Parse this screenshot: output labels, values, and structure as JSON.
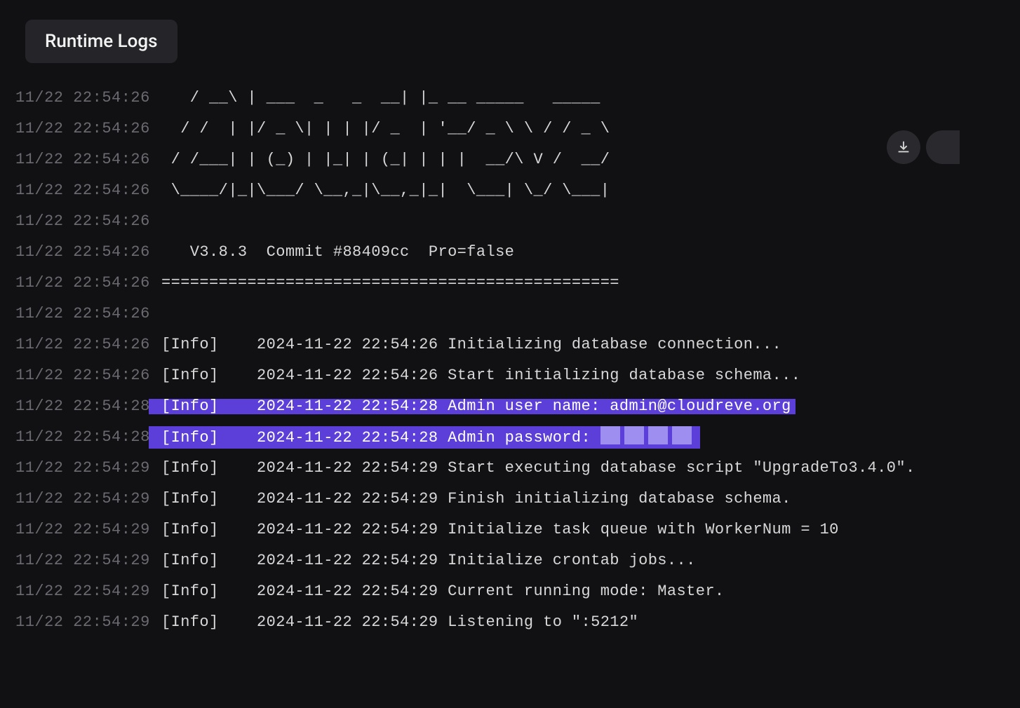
{
  "tab": {
    "label": "Runtime Logs"
  },
  "icons": {
    "download": "download-icon"
  },
  "log": {
    "lines": [
      {
        "ts": "11/22 22:54:26",
        "msg": "   / __\\ | ___  _   _  __| |_ __ _____   _____",
        "hl": false
      },
      {
        "ts": "11/22 22:54:26",
        "msg": "  / /  | |/ _ \\| | | |/ _  | '__/ _ \\ \\ / / _ \\",
        "hl": false
      },
      {
        "ts": "11/22 22:54:26",
        "msg": " / /___| | (_) | |_| | (_| | | |  __/\\ V /  __/",
        "hl": false
      },
      {
        "ts": "11/22 22:54:26",
        "msg": " \\____/|_|\\___/ \\__,_|\\__,_|_|  \\___| \\_/ \\___|",
        "hl": false
      },
      {
        "ts": "11/22 22:54:26",
        "msg": "",
        "hl": false
      },
      {
        "ts": "11/22 22:54:26",
        "msg": "   V3.8.3  Commit #88409cc  Pro=false",
        "hl": false
      },
      {
        "ts": "11/22 22:54:26",
        "msg": "================================================",
        "hl": false
      },
      {
        "ts": "11/22 22:54:26",
        "msg": "",
        "hl": false
      },
      {
        "ts": "11/22 22:54:26",
        "msg": "[Info]    2024-11-22 22:54:26 Initializing database connection...",
        "hl": false
      },
      {
        "ts": "11/22 22:54:26",
        "msg": "[Info]    2024-11-22 22:54:26 Start initializing database schema...",
        "hl": false
      },
      {
        "ts": "11/22 22:54:28",
        "msg": "[Info]    2024-11-22 22:54:28 Admin user name: admin@cloudreve.org",
        "hl": true
      },
      {
        "ts": "11/22 22:54:28",
        "msg": "[Info]    2024-11-22 22:54:28 Admin password: ",
        "hl": true,
        "redacted": true
      },
      {
        "ts": "11/22 22:54:29",
        "msg": "[Info]    2024-11-22 22:54:29 Start executing database script \"UpgradeTo3.4.0\".",
        "hl": false
      },
      {
        "ts": "11/22 22:54:29",
        "msg": "[Info]    2024-11-22 22:54:29 Finish initializing database schema.",
        "hl": false
      },
      {
        "ts": "11/22 22:54:29",
        "msg": "[Info]    2024-11-22 22:54:29 Initialize task queue with WorkerNum = 10",
        "hl": false
      },
      {
        "ts": "11/22 22:54:29",
        "msg": "[Info]    2024-11-22 22:54:29 Initialize crontab jobs...",
        "hl": false
      },
      {
        "ts": "11/22 22:54:29",
        "msg": "[Info]    2024-11-22 22:54:29 Current running mode: Master.",
        "hl": false
      },
      {
        "ts": "11/22 22:54:29",
        "msg": "[Info]    2024-11-22 22:54:29 Listening to \":5212\"",
        "hl": false
      }
    ]
  }
}
